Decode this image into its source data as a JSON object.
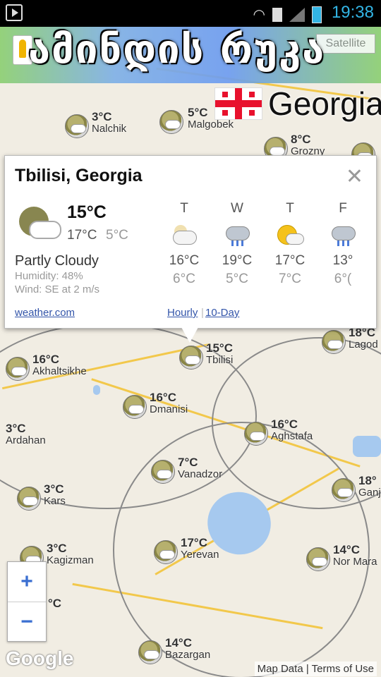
{
  "status_bar": {
    "time": "19:38"
  },
  "banner": {
    "title": "ამინდის რუკა",
    "country": "Georgia",
    "map_type_button": "Satellite"
  },
  "popup": {
    "city": "Tbilisi, Georgia",
    "close": "✕",
    "current": {
      "temp": "15°C",
      "high": "17°C",
      "low": "5°C"
    },
    "condition": "Partly Cloudy",
    "humidity": "Humidity: 48%",
    "wind": "Wind: SE at 2 m/s",
    "source_link": "weather.com",
    "hourly_link": "Hourly",
    "tenday_link": "10-Day",
    "forecast": [
      {
        "day": "T",
        "icon": "partly-cloudy-icon",
        "high": "16°C",
        "low": "6°C"
      },
      {
        "day": "W",
        "icon": "rain-icon",
        "high": "19°C",
        "low": "5°C"
      },
      {
        "day": "T",
        "icon": "sun-cloud-icon",
        "high": "17°C",
        "low": "7°C"
      },
      {
        "day": "F",
        "icon": "rain-icon",
        "high": "13°",
        "low": "6°("
      }
    ]
  },
  "map_markers": [
    {
      "temp": "3°C",
      "name": "Nalchik"
    },
    {
      "temp": "5°C",
      "name": "Malgobek"
    },
    {
      "temp": "8°C",
      "name": "Grozny"
    },
    {
      "temp": "18°C",
      "name": "Lagod"
    },
    {
      "temp": "15°C",
      "name": "Tbilisi"
    },
    {
      "temp": "16°C",
      "name": "Akhaltsikhe"
    },
    {
      "temp": "16°C",
      "name": "Dmanisi"
    },
    {
      "temp": "3°C",
      "name": "Ardahan"
    },
    {
      "temp": "16°C",
      "name": "Aghstafa"
    },
    {
      "temp": "7°C",
      "name": "Vanadzor"
    },
    {
      "temp": "3°C",
      "name": "Kars"
    },
    {
      "temp": "18°",
      "name": "Ganj"
    },
    {
      "temp": "3°C",
      "name": "Kagizman"
    },
    {
      "temp": "17°C",
      "name": "Yerevan"
    },
    {
      "temp": "14°C",
      "name": "Nor Mara"
    },
    {
      "temp": "°C",
      "name": ""
    },
    {
      "temp": "14°C",
      "name": "Bazargan"
    }
  ],
  "zoom": {
    "in": "+",
    "out": "−"
  },
  "logo": "Google",
  "attribution": {
    "map_data": "Map Data",
    "terms": "Terms of Use"
  }
}
